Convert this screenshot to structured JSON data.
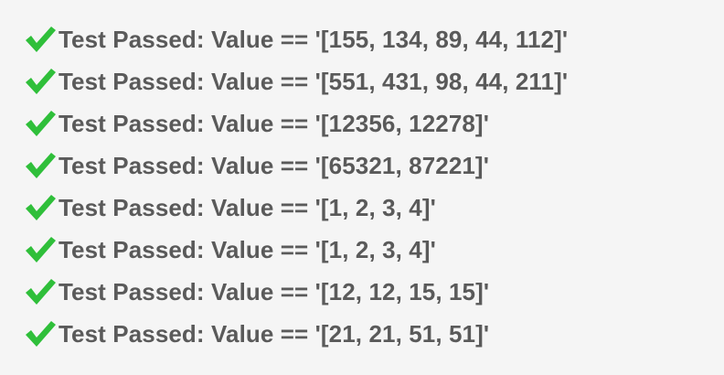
{
  "results": [
    {
      "icon": "check-icon",
      "text": "Test Passed: Value == '[155, 134, 89, 44, 112]'"
    },
    {
      "icon": "check-icon",
      "text": "Test Passed: Value == '[551, 431, 98, 44, 211]'"
    },
    {
      "icon": "check-icon",
      "text": "Test Passed: Value == '[12356, 12278]'"
    },
    {
      "icon": "check-icon",
      "text": "Test Passed: Value == '[65321, 87221]'"
    },
    {
      "icon": "check-icon",
      "text": "Test Passed: Value == '[1, 2, 3, 4]'"
    },
    {
      "icon": "check-icon",
      "text": "Test Passed: Value == '[1, 2, 3, 4]'"
    },
    {
      "icon": "check-icon",
      "text": "Test Passed: Value == '[12, 12, 15, 15]'"
    },
    {
      "icon": "check-icon",
      "text": "Test Passed: Value == '[21, 21, 51, 51]'"
    }
  ],
  "colors": {
    "background": "#f5f5f5",
    "check": "#2fbf3a",
    "text": "#5a5a5a"
  }
}
